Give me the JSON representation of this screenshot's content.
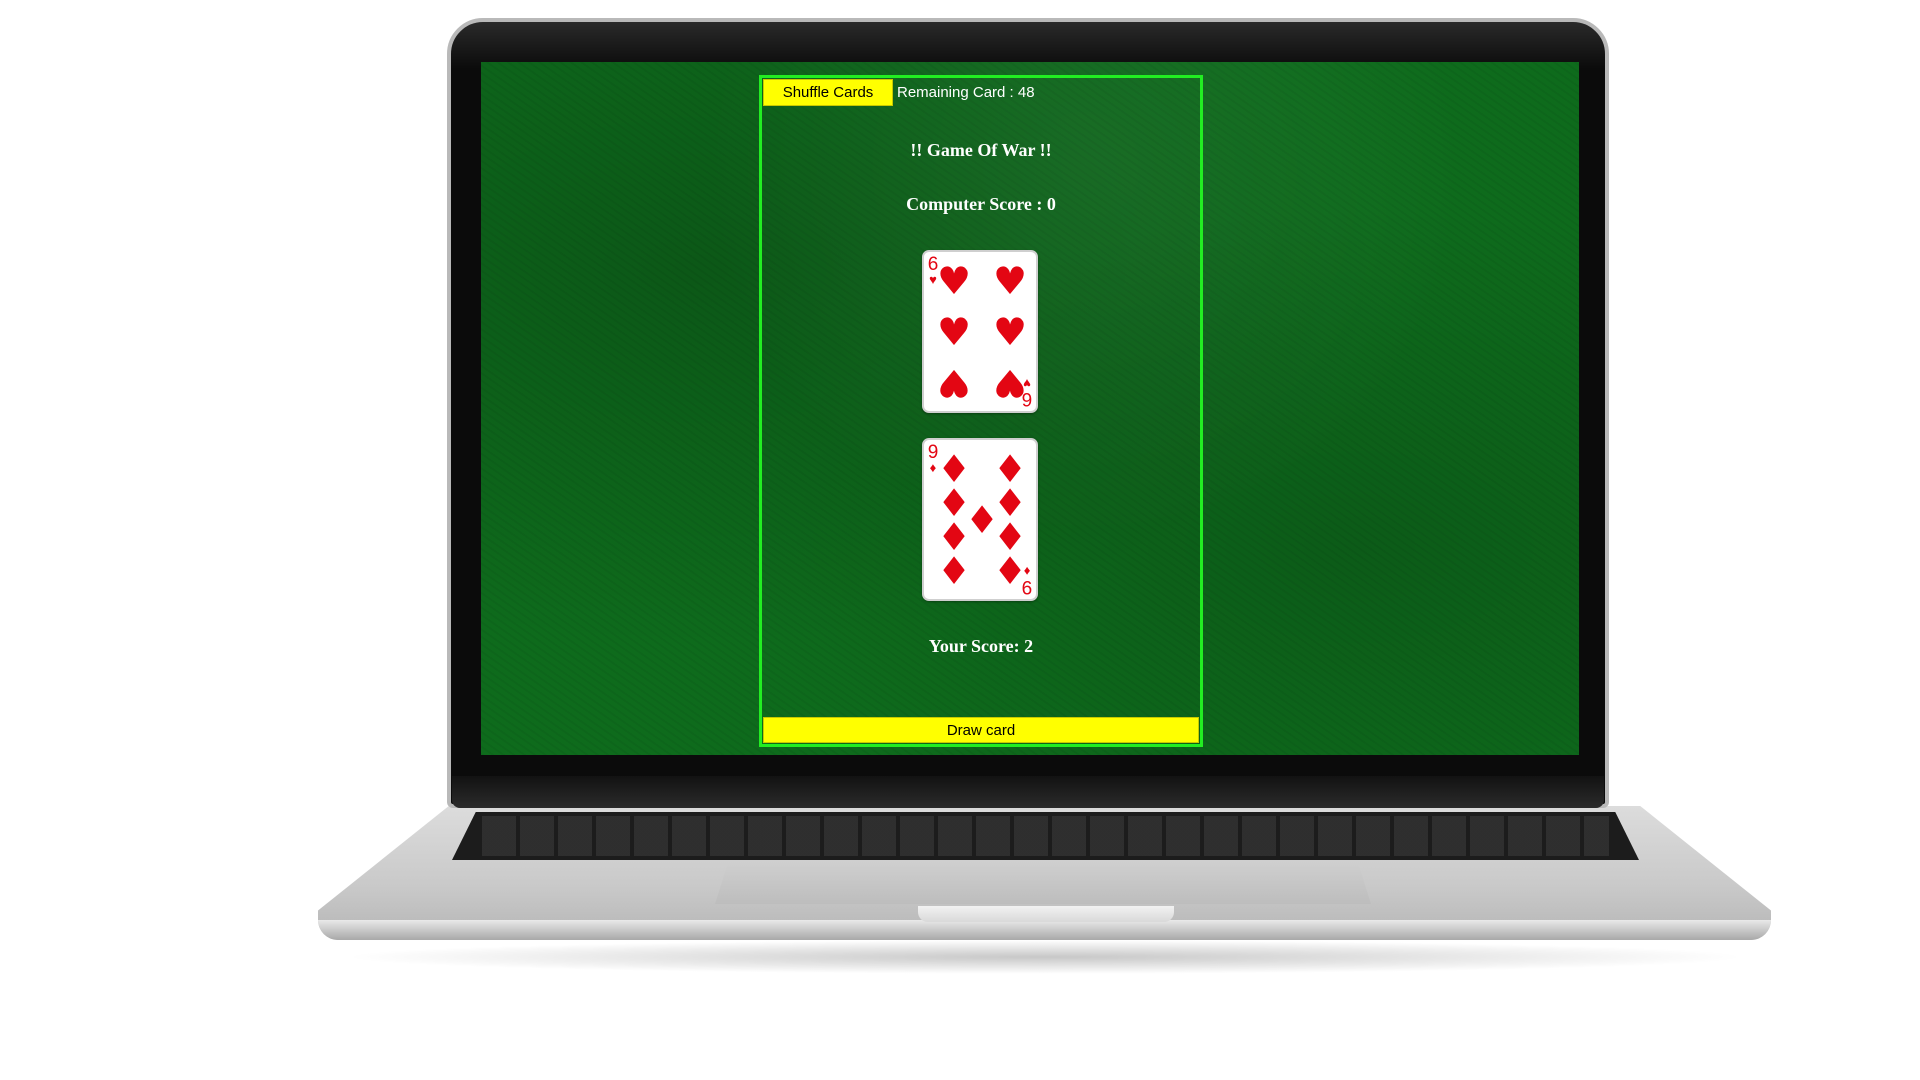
{
  "app": {
    "shuffle_label": "Shuffle Cards",
    "remaining_text": "Remaining Card : 48",
    "title": "!! Game Of War !!",
    "computer_score_text": "Computer Score : 0",
    "your_score_text": "Your Score: 2",
    "draw_label": "Draw card"
  },
  "cards": {
    "computer": {
      "rank": "6",
      "suit": "♥",
      "suit_name": "hearts",
      "color": "#e30613"
    },
    "player": {
      "rank": "9",
      "suit": "♦",
      "suit_name": "diamonds",
      "color": "#e30613"
    }
  },
  "colors": {
    "felt": "#0e6b1c",
    "panel_border": "#22ee22",
    "button": "#ffff00",
    "card_red": "#e30613"
  }
}
